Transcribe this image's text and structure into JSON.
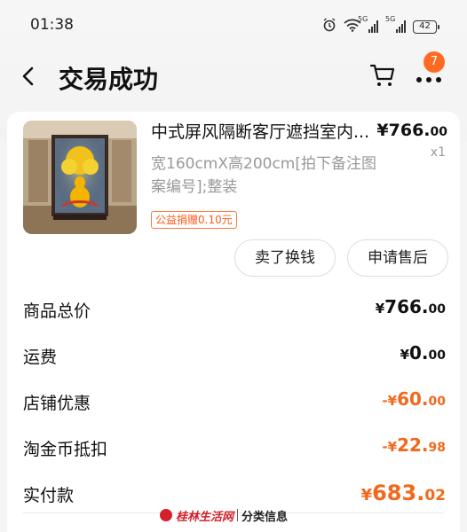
{
  "status_bar": {
    "time": "01:38",
    "network_tag_1": "5G",
    "network_tag_2": "5G",
    "battery": "42"
  },
  "nav": {
    "title": "交易成功",
    "badge_count": "7"
  },
  "product": {
    "title": "中式屏风隔断客厅遮挡室内...",
    "price_int": "¥766.",
    "price_dec": "00",
    "quantity": "x1",
    "spec": "宽160cmX高200cm[拍下备注图案编号];整装",
    "charity_tag": "公益捐赠0.10元"
  },
  "actions": {
    "sell_label": "卖了换钱",
    "after_sale_label": "申请售后"
  },
  "summary": {
    "rows": [
      {
        "label": "商品总价",
        "cur": "¥",
        "int": "766.",
        "dec": "00"
      },
      {
        "label": "运费",
        "cur": "¥",
        "int": "0.",
        "dec": "00"
      },
      {
        "label": "店铺优惠",
        "cur": "-¥",
        "int": "60.",
        "dec": "00"
      },
      {
        "label": "淘金币抵扣",
        "cur": "-¥",
        "int": "22.",
        "dec": "98"
      },
      {
        "label": "实付款",
        "cur": "¥",
        "int": "683.",
        "dec": "02"
      }
    ]
  },
  "watermark": {
    "site": "桂林生活网",
    "section": "分类信息"
  },
  "colors": {
    "accent": "#f2691c",
    "badge": "#ff6a22"
  }
}
